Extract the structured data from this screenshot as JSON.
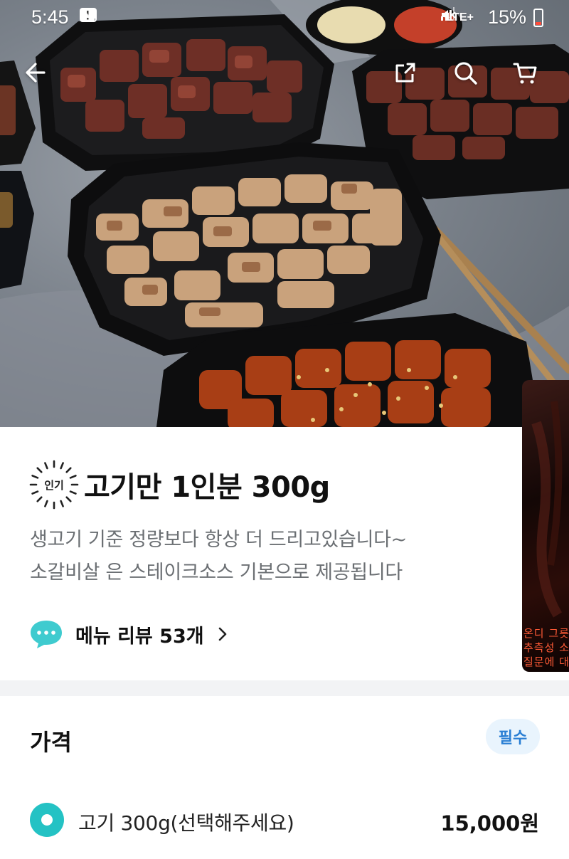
{
  "status_bar": {
    "time": "5:45",
    "network": "LTE+",
    "battery": "15%"
  },
  "menu": {
    "badge": "인기",
    "title": "고기만 1인분 300g",
    "description_lines": [
      "생고기 기준 정량보다 항상 더 드리고있습니다~",
      "소갈비살 은 스테이크소스 기본으로 제공됩니다"
    ],
    "review_label": "메뉴 리뷰 53개"
  },
  "video_overlay_text": [
    "온디 그릇",
    "추측성 소",
    "질문에 대"
  ],
  "price": {
    "section_title": "가격",
    "required_badge": "필수",
    "options": [
      {
        "label": "고기 300g(선택해주세요)",
        "price": "15,000원",
        "selected": true
      }
    ]
  },
  "colors": {
    "accent_teal": "#24c2c4",
    "required_bg": "#e9f4fd",
    "required_text": "#2a7fd4"
  },
  "icons": [
    "back-arrow-icon",
    "share-icon",
    "search-icon",
    "cart-icon",
    "chat-bubble-icon",
    "chevron-right-icon"
  ]
}
